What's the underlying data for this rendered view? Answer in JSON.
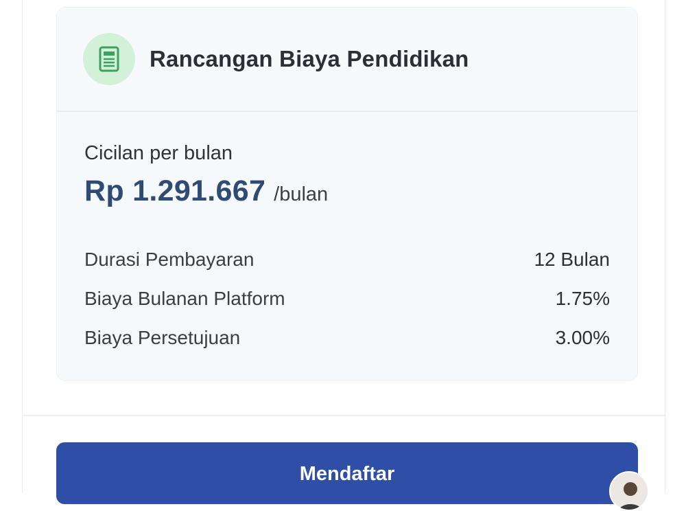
{
  "card": {
    "title": "Rancangan Biaya Pendidikan",
    "icon": "document-icon",
    "installment_label": "Cicilan per bulan",
    "amount": "Rp 1.291.667",
    "amount_unit": "/bulan",
    "details": [
      {
        "label": "Durasi Pembayaran",
        "value": "12 Bulan"
      },
      {
        "label": "Biaya Bulanan Platform",
        "value": "1.75%"
      },
      {
        "label": "Biaya Persetujuan",
        "value": "3.00%"
      }
    ]
  },
  "actions": {
    "register_label": "Mendaftar"
  },
  "colors": {
    "accent": "#2f4ea6",
    "amount": "#2f4a74",
    "icon_bg": "#d3f0d9",
    "icon_fg": "#3aa25a",
    "card_bg": "#f6f9fc"
  }
}
